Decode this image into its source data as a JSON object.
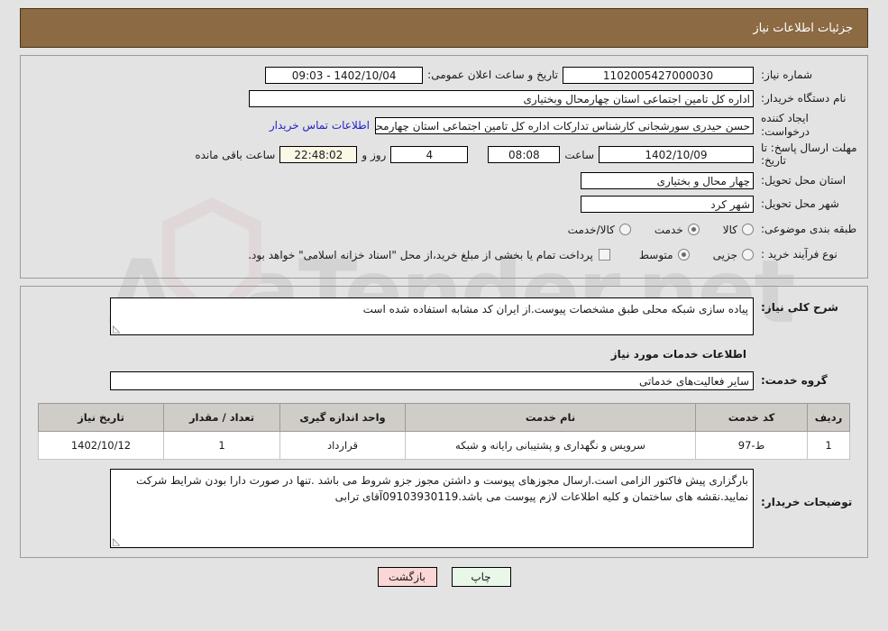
{
  "header": {
    "title": "جزئیات اطلاعات نیاز"
  },
  "watermark": {
    "text": "AriaTender.net"
  },
  "info": {
    "need_number": {
      "label": "شماره نیاز:",
      "value": "1102005427000030"
    },
    "public_announce": {
      "label": "تاریخ و ساعت اعلان عمومی:",
      "value": "1402/10/04 - 09:03"
    },
    "buyer_org": {
      "label": "نام دستگاه خریدار:",
      "value": "اداره کل تامین اجتماعی استان چهارمحال وبختیاری"
    },
    "requester": {
      "label": "ایجاد کننده درخواست:",
      "value": "حسن حیدری سورشجانی کارشناس تدارکات اداره کل تامین اجتماعی استان چهارمحال وبختیاری",
      "contact_link": "اطلاعات تماس خریدار"
    },
    "deadline": {
      "label": "مهلت ارسال پاسخ: تا تاریخ:",
      "date": "1402/10/09",
      "time_label": "ساعت",
      "time": "08:08",
      "days": "4",
      "days_and_label": "روز و",
      "countdown": "22:48:02",
      "remaining_label": "ساعت باقی مانده"
    },
    "delivery_province": {
      "label": "استان محل تحویل:",
      "value": "چهار محال و بختیاری"
    },
    "delivery_city": {
      "label": "شهر محل تحویل:",
      "value": "شهر کرد"
    },
    "category": {
      "label": "طبقه بندی موضوعی:",
      "options": [
        {
          "label": "کالا",
          "checked": false
        },
        {
          "label": "خدمت",
          "checked": true
        },
        {
          "label": "کالا/خدمت",
          "checked": false
        }
      ]
    },
    "process_type": {
      "label": "نوع فرآیند خرید :",
      "options": [
        {
          "label": "جزیی",
          "checked": false
        },
        {
          "label": "متوسط",
          "checked": true
        }
      ],
      "treasury_checkbox": {
        "checked": false,
        "label": "پرداخت تمام یا بخشی از مبلغ خرید،از محل \"اسناد خزانه اسلامی\" خواهد بود."
      }
    }
  },
  "description": {
    "need_summary": {
      "label": "شرح کلی نیاز:",
      "value": "پیاده سازی شبکه محلی طبق مشخصات پیوست.از ایران کد مشابه استفاده شده است"
    },
    "services_section_title": "اطلاعات خدمات مورد نیاز",
    "service_group": {
      "label": "گروه خدمت:",
      "value": "سایر فعالیت‌های خدماتی"
    },
    "table": {
      "columns": [
        "ردیف",
        "کد خدمت",
        "نام خدمت",
        "واحد اندازه گیری",
        "تعداد / مقدار",
        "تاریخ نیاز"
      ],
      "rows": [
        {
          "row_no": "1",
          "service_code": "ط-97",
          "service_name": "سرویس و نگهداری و پشتیبانی رایانه و شبکه",
          "unit": "قرارداد",
          "quantity": "1",
          "need_date": "1402/10/12"
        }
      ]
    },
    "buyer_notes": {
      "label": "توضیحات خریدار:",
      "value": "بارگزاری پیش فاکتور الزامی است.ارسال مجوزهای پیوست و داشتن مجوز جزو شروط می باشد .تنها در صورت دارا بودن شرایط شرکت نمایید.نقشه های ساختمان و کلیه اطلاعات لازم پیوست می باشد.09103930119آقای ترابی"
    }
  },
  "footer": {
    "print_button": "چاپ",
    "back_button": "بازگشت"
  }
}
